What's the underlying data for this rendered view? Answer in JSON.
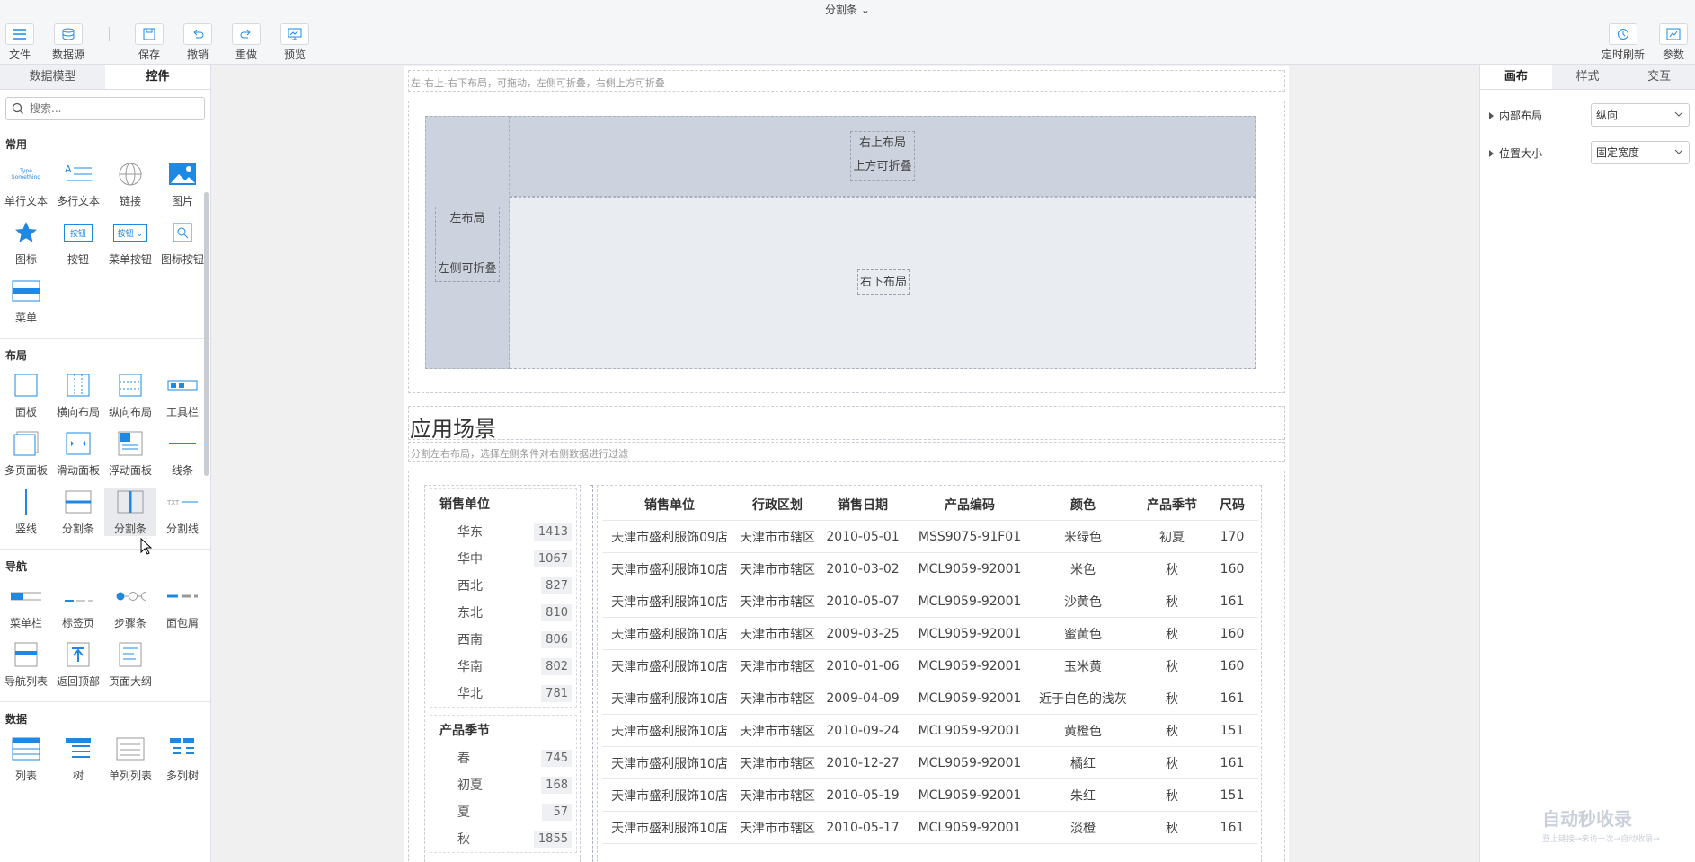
{
  "header": {
    "title": "分割条",
    "left_buttons": [
      {
        "label": "文件",
        "icon": "menu-icon"
      },
      {
        "label": "数据源",
        "icon": "database-icon"
      }
    ],
    "edit_buttons": [
      {
        "label": "保存",
        "icon": "save-icon"
      },
      {
        "label": "撤销",
        "icon": "undo-icon"
      },
      {
        "label": "重做",
        "icon": "redo-icon"
      },
      {
        "label": "预览",
        "icon": "preview-icon"
      }
    ],
    "right_buttons": [
      {
        "label": "定时刷新",
        "icon": "history-icon"
      },
      {
        "label": "参数",
        "icon": "parameter-icon"
      }
    ]
  },
  "left_panel": {
    "tabs": [
      "数据模型",
      "控件"
    ],
    "active_tab": "控件",
    "search_placeholder": "搜索...",
    "sections": [
      {
        "title": "常用",
        "items": [
          "单行文本",
          "多行文本",
          "链接",
          "图片",
          "图标",
          "按钮",
          "菜单按钮",
          "图标按钮",
          "菜单"
        ]
      },
      {
        "title": "布局",
        "items": [
          "面板",
          "横向布局",
          "纵向布局",
          "工具栏",
          "多页面板",
          "滑动面板",
          "浮动面板",
          "线条",
          "竖线",
          "分割条",
          "分割条",
          "分割线"
        ]
      },
      {
        "title": "导航",
        "items": [
          "菜单栏",
          "标签页",
          "步骤条",
          "面包屑",
          "导航列表",
          "返回顶部",
          "页面大纲"
        ]
      },
      {
        "title": "数据",
        "items": [
          "列表",
          "树",
          "单列列表",
          "多列树"
        ]
      }
    ],
    "icon_text": {
      "single_text": "Type Something",
      "button": "按钮",
      "menu_button": "按钮",
      "splitline": "TXT"
    }
  },
  "canvas": {
    "hint_top": "左-右上-右下布局，可拖动，左侧可折叠，右侧上方可折叠",
    "demo": {
      "left_label_1": "左布局",
      "left_label_2": "左侧可折叠",
      "top_label_1": "右上布局",
      "top_label_2": "上方可折叠",
      "bottom_label": "右下布局"
    },
    "section_title": "应用场景",
    "section_hint": "分割左右布局，选择左侧条件对右侧数据进行过滤",
    "filters": [
      {
        "title": "销售单位",
        "items": [
          {
            "label": "华东",
            "count": "1413"
          },
          {
            "label": "华中",
            "count": "1067"
          },
          {
            "label": "西北",
            "count": "827"
          },
          {
            "label": "东北",
            "count": "810"
          },
          {
            "label": "西南",
            "count": "806"
          },
          {
            "label": "华南",
            "count": "802"
          },
          {
            "label": "华北",
            "count": "781"
          }
        ]
      },
      {
        "title": "产品季节",
        "items": [
          {
            "label": "春",
            "count": "745"
          },
          {
            "label": "初夏",
            "count": "168"
          },
          {
            "label": "夏",
            "count": "57"
          },
          {
            "label": "秋",
            "count": "1855"
          }
        ]
      }
    ],
    "table": {
      "columns": [
        "销售单位",
        "行政区划",
        "销售日期",
        "产品编码",
        "颜色",
        "产品季节",
        "尺码"
      ],
      "rows": [
        [
          "天津市盛利服饰09店",
          "天津市市辖区",
          "2010-05-01",
          "MSS9075-91F01",
          "米绿色",
          "初夏",
          "170"
        ],
        [
          "天津市盛利服饰10店",
          "天津市市辖区",
          "2010-03-02",
          "MCL9059-92001",
          "米色",
          "秋",
          "160"
        ],
        [
          "天津市盛利服饰10店",
          "天津市市辖区",
          "2010-05-07",
          "MCL9059-92001",
          "沙黄色",
          "秋",
          "161"
        ],
        [
          "天津市盛利服饰10店",
          "天津市市辖区",
          "2009-03-25",
          "MCL9059-92001",
          "蜜黄色",
          "秋",
          "160"
        ],
        [
          "天津市盛利服饰10店",
          "天津市市辖区",
          "2010-01-06",
          "MCL9059-92001",
          "玉米黄",
          "秋",
          "160"
        ],
        [
          "天津市盛利服饰10店",
          "天津市市辖区",
          "2009-04-09",
          "MCL9059-92001",
          "近于白色的浅灰",
          "秋",
          "161"
        ],
        [
          "天津市盛利服饰10店",
          "天津市市辖区",
          "2010-09-24",
          "MCL9059-92001",
          "黄橙色",
          "秋",
          "151"
        ],
        [
          "天津市盛利服饰10店",
          "天津市市辖区",
          "2010-12-27",
          "MCL9059-92001",
          "橘红",
          "秋",
          "161"
        ],
        [
          "天津市盛利服饰10店",
          "天津市市辖区",
          "2010-05-19",
          "MCL9059-92001",
          "朱红",
          "秋",
          "151"
        ],
        [
          "天津市盛利服饰10店",
          "天津市市辖区",
          "2010-05-17",
          "MCL9059-92001",
          "淡橙",
          "秋",
          "161"
        ]
      ]
    }
  },
  "right_panel": {
    "tabs": [
      "画布",
      "样式",
      "交互"
    ],
    "active_tab": "画布",
    "properties": [
      {
        "label": "内部布局",
        "value": "纵向"
      },
      {
        "label": "位置大小",
        "value": "固定宽度"
      }
    ]
  },
  "watermark": {
    "text": "自动秒收录",
    "sub": "登上链接→来访一次→自动收录→"
  },
  "colors": {
    "accent": "#1e88e5",
    "layout_dark": "#cdd3de",
    "layout_light": "#e9ecf1"
  }
}
